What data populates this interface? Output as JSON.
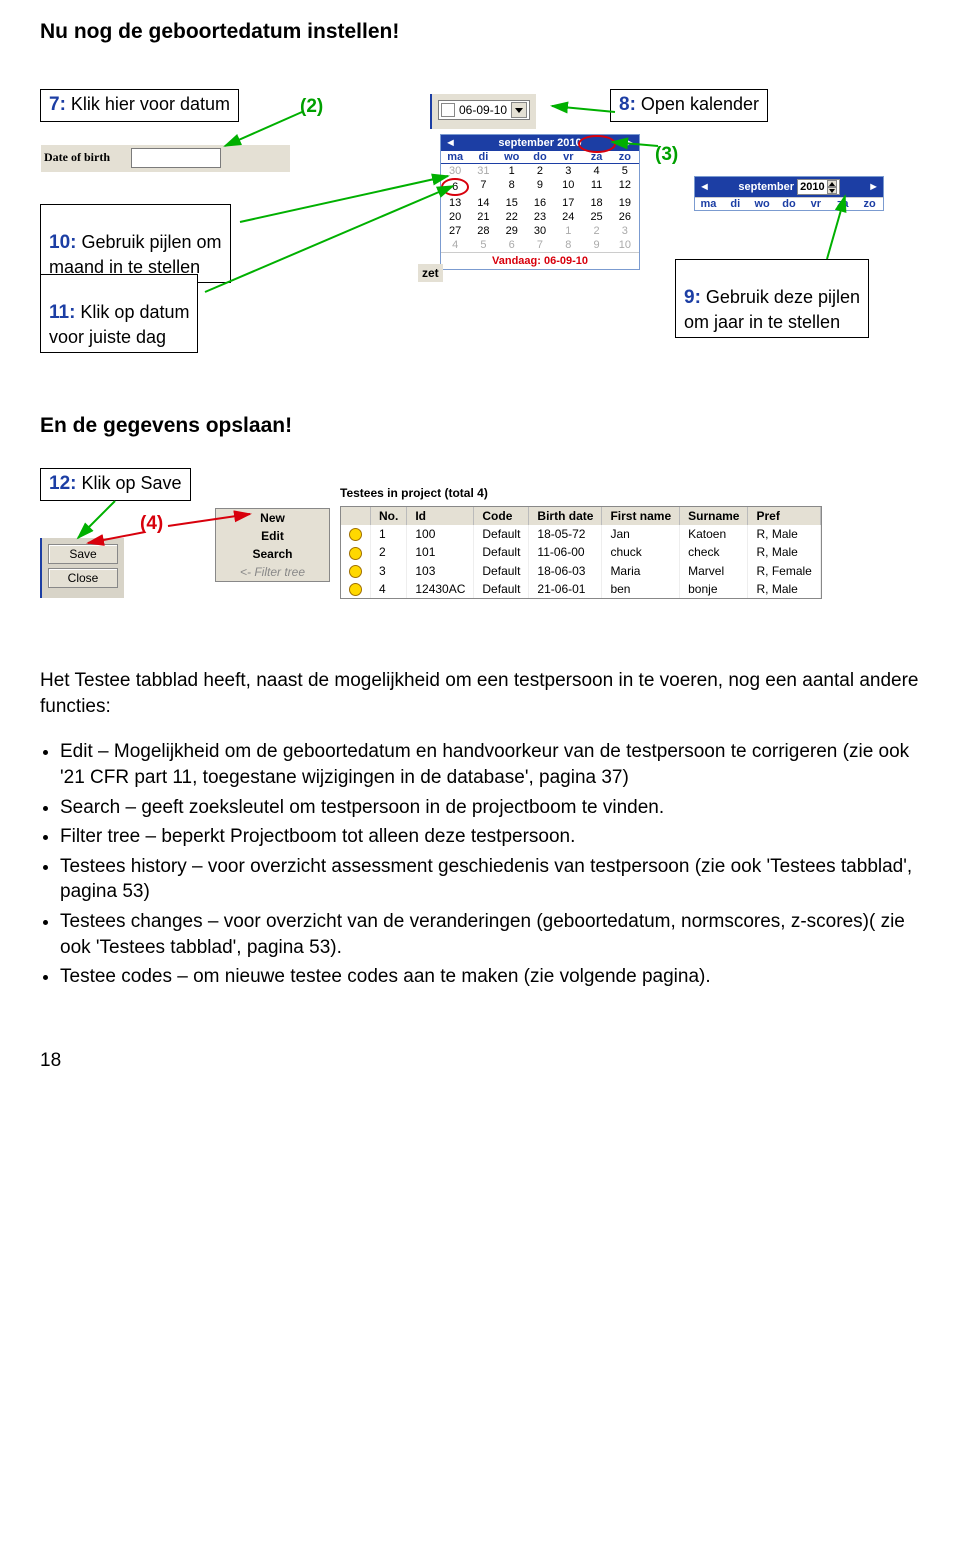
{
  "title": "Nu nog de geboortedatum instellen!",
  "callouts": {
    "c7": {
      "num": "7:",
      "text": " Klik hier voor datum",
      "subnum": "(2)"
    },
    "c8": {
      "num": "8:",
      "text": " Open kalender"
    },
    "c8sub": "(3)",
    "c10": {
      "num": "10:",
      "text": " Gebruik pijlen om\nmaand in te stellen"
    },
    "c11": {
      "num": "11:",
      "text": " Klik op datum\nvoor juiste dag"
    },
    "c9": {
      "num": "9:",
      "text": " Gebruik deze pijlen\nom jaar in te stellen"
    },
    "c12": {
      "num": "12:",
      "text": " Klik op Save",
      "subnum": "(4)"
    }
  },
  "winfield": {
    "label": "Date of birth",
    "drop_value": "06-09-10"
  },
  "calendar_main": {
    "title": "september 2010",
    "dow": [
      "ma",
      "di",
      "wo",
      "do",
      "vr",
      "za",
      "zo"
    ],
    "days": [
      {
        "t": "30",
        "d": true
      },
      {
        "t": "31",
        "d": true
      },
      {
        "t": "1"
      },
      {
        "t": "2"
      },
      {
        "t": "3"
      },
      {
        "t": "4"
      },
      {
        "t": "5"
      },
      {
        "t": "6",
        "c": true
      },
      {
        "t": "7"
      },
      {
        "t": "8"
      },
      {
        "t": "9"
      },
      {
        "t": "10"
      },
      {
        "t": "11"
      },
      {
        "t": "12"
      },
      {
        "t": "13"
      },
      {
        "t": "14"
      },
      {
        "t": "15"
      },
      {
        "t": "16"
      },
      {
        "t": "17"
      },
      {
        "t": "18"
      },
      {
        "t": "19"
      },
      {
        "t": "20"
      },
      {
        "t": "21"
      },
      {
        "t": "22"
      },
      {
        "t": "23"
      },
      {
        "t": "24"
      },
      {
        "t": "25"
      },
      {
        "t": "26"
      },
      {
        "t": "27"
      },
      {
        "t": "28"
      },
      {
        "t": "29"
      },
      {
        "t": "30"
      },
      {
        "t": "1",
        "d": true
      },
      {
        "t": "2",
        "d": true
      },
      {
        "t": "3",
        "d": true
      },
      {
        "t": "4",
        "d": true
      },
      {
        "t": "5",
        "d": true
      },
      {
        "t": "6",
        "d": true
      },
      {
        "t": "7",
        "d": true
      },
      {
        "t": "8",
        "d": true
      },
      {
        "t": "9",
        "d": true
      },
      {
        "t": "10",
        "d": true
      }
    ],
    "today": "Vandaag: 06-09-10"
  },
  "calendar_small": {
    "title": "september",
    "year": "2010",
    "dow": [
      "ma",
      "di",
      "wo",
      "do",
      "vr",
      "za",
      "zo"
    ]
  },
  "zet_label": "zet",
  "heading2": "En de gegevens opslaan!",
  "buttons": {
    "save": "Save",
    "close": "Close"
  },
  "menu": {
    "new": "New",
    "edit": "Edit",
    "search": "Search",
    "filter": "<- Filter tree"
  },
  "testees_title": "Testees in project (total 4)",
  "table": {
    "headers": [
      "No.",
      "Id",
      "Code",
      "Birth date",
      "First name",
      "Surname",
      "Pref"
    ],
    "rows": [
      [
        "1",
        "100",
        "Default",
        "18-05-72",
        "Jan",
        "Katoen",
        "R, Male"
      ],
      [
        "2",
        "101",
        "Default",
        "11-06-00",
        "chuck",
        "check",
        "R, Male"
      ],
      [
        "3",
        "103",
        "Default",
        "18-06-03",
        "Maria",
        "Marvel",
        "R, Female"
      ],
      [
        "4",
        "12430AC",
        "Default",
        "21-06-01",
        "ben",
        "bonje",
        "R, Male"
      ]
    ]
  },
  "body1": "Het Testee tabblad heeft, naast de mogelijkheid om een testpersoon in te voeren, nog een aantal andere functies:",
  "bullets": [
    "Edit – Mogelijkheid om de geboortedatum en handvoorkeur van de testpersoon te corrigeren (zie ook '21 CFR part 11, toegestane wijzigingen in de database', pagina 37)",
    "Search – geeft zoeksleutel om testpersoon in de projectboom te vinden.",
    "Filter tree – beperkt Projectboom tot alleen deze testpersoon.",
    "Testees history – voor overzicht assessment geschiedenis van testpersoon (zie ook 'Testees tabblad', pagina 53)",
    "Testees changes – voor overzicht van de veranderingen (geboortedatum, normscores, z-scores)( zie ook 'Testees tabblad', pagina 53).",
    "Testee codes – om nieuwe testee codes aan te maken (zie volgende pagina)."
  ],
  "page_number": "18"
}
